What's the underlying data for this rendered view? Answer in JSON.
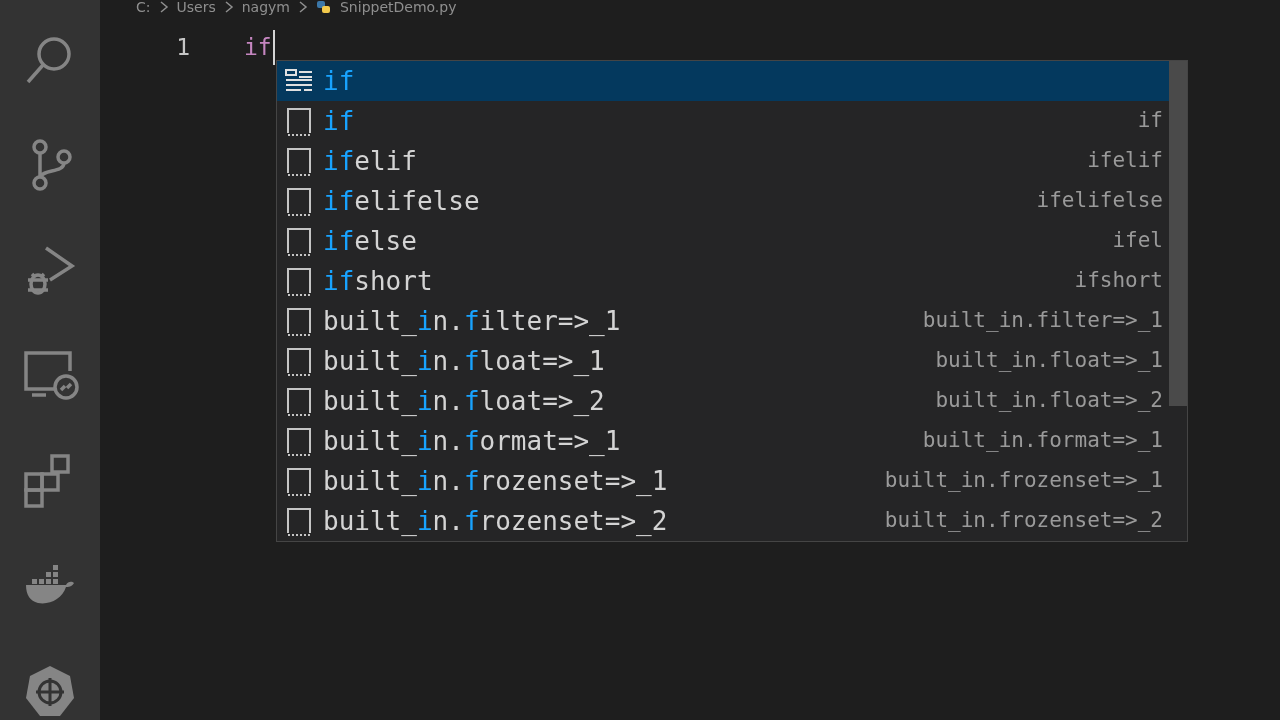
{
  "breadcrumb": [
    "C:",
    "Users",
    "nagym",
    "SnippetDemo.py"
  ],
  "activity_bar": [
    {
      "kind": "search"
    },
    {
      "kind": "source-control"
    },
    {
      "kind": "run-debug"
    },
    {
      "kind": "remote"
    },
    {
      "kind": "extensions"
    },
    {
      "kind": "docker"
    },
    {
      "kind": "kubernetes"
    }
  ],
  "editor": {
    "lines": [
      {
        "number": "1",
        "text": "if"
      }
    ]
  },
  "suggestions": [
    {
      "kind": "keyword",
      "selected": true,
      "label": [
        {
          "text": "if",
          "match": true
        }
      ]
    },
    {
      "kind": "snippet",
      "selected": false,
      "label": [
        {
          "text": "if",
          "match": true
        }
      ],
      "detail": "if"
    },
    {
      "kind": "snippet",
      "selected": false,
      "label": [
        {
          "text": "if",
          "match": true
        },
        {
          "text": "elif",
          "match": false
        }
      ],
      "detail": "ifelif"
    },
    {
      "kind": "snippet",
      "selected": false,
      "label": [
        {
          "text": "if",
          "match": true
        },
        {
          "text": "elifelse",
          "match": false
        }
      ],
      "detail": "ifelifelse"
    },
    {
      "kind": "snippet",
      "selected": false,
      "label": [
        {
          "text": "if",
          "match": true
        },
        {
          "text": "else",
          "match": false
        }
      ],
      "detail": "ifel"
    },
    {
      "kind": "snippet",
      "selected": false,
      "label": [
        {
          "text": "if",
          "match": true
        },
        {
          "text": "short",
          "match": false
        }
      ],
      "detail": "ifshort"
    },
    {
      "kind": "snippet",
      "selected": false,
      "label": [
        {
          "text": "built_",
          "match": false
        },
        {
          "text": "i",
          "match": true
        },
        {
          "text": "n.",
          "match": false
        },
        {
          "text": "f",
          "match": true
        },
        {
          "text": "ilter=>_1",
          "match": false
        }
      ],
      "detail": "built_in.filter=>_1"
    },
    {
      "kind": "snippet",
      "selected": false,
      "label": [
        {
          "text": "built_",
          "match": false
        },
        {
          "text": "i",
          "match": true
        },
        {
          "text": "n.",
          "match": false
        },
        {
          "text": "f",
          "match": true
        },
        {
          "text": "loat=>_1",
          "match": false
        }
      ],
      "detail": "built_in.float=>_1"
    },
    {
      "kind": "snippet",
      "selected": false,
      "label": [
        {
          "text": "built_",
          "match": false
        },
        {
          "text": "i",
          "match": true
        },
        {
          "text": "n.",
          "match": false
        },
        {
          "text": "f",
          "match": true
        },
        {
          "text": "loat=>_2",
          "match": false
        }
      ],
      "detail": "built_in.float=>_2"
    },
    {
      "kind": "snippet",
      "selected": false,
      "label": [
        {
          "text": "built_",
          "match": false
        },
        {
          "text": "i",
          "match": true
        },
        {
          "text": "n.",
          "match": false
        },
        {
          "text": "f",
          "match": true
        },
        {
          "text": "ormat=>_1",
          "match": false
        }
      ],
      "detail": "built_in.format=>_1"
    },
    {
      "kind": "snippet",
      "selected": false,
      "label": [
        {
          "text": "built_",
          "match": false
        },
        {
          "text": "i",
          "match": true
        },
        {
          "text": "n.",
          "match": false
        },
        {
          "text": "f",
          "match": true
        },
        {
          "text": "rozenset=>_1",
          "match": false
        }
      ],
      "detail": "built_in.frozenset=>_1"
    },
    {
      "kind": "snippet",
      "selected": false,
      "label": [
        {
          "text": "built_",
          "match": false
        },
        {
          "text": "i",
          "match": true
        },
        {
          "text": "n.",
          "match": false
        },
        {
          "text": "f",
          "match": true
        },
        {
          "text": "rozenset=>_2",
          "match": false
        }
      ],
      "detail": "built_in.frozenset=>_2"
    }
  ]
}
